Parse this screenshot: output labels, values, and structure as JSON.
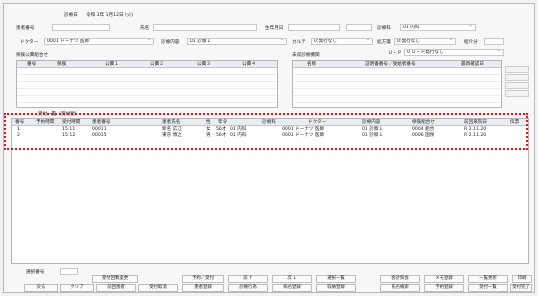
{
  "header": {
    "date_label": "診療日",
    "date_value": "令和 3年 1月12日 (火)",
    "patient_no_label": "患者番号",
    "name_label": "氏名",
    "birthdate_label": "生年月日",
    "dept_label": "診療科",
    "dept_value": "01 内科"
  },
  "row2": {
    "doctor_label": "ドクター",
    "doctor_value": "0001 ドーナツ 医師",
    "content_label": "診療内容",
    "content_value": "01 診察１",
    "karte_label": "カルテ",
    "karte_value": "0:発行なし",
    "prescription_label": "処方箋",
    "prescription_value": "0:発行なし",
    "referral_label": "紹介分"
  },
  "insurance": {
    "title": "保険公費組合せ",
    "columns": [
      "番号",
      "保険",
      "公費１",
      "公費２",
      "公費３",
      "公費４"
    ]
  },
  "receipt_option": {
    "label": "Ｕ・Ｐ",
    "value": "0 Ｕ・Ｐ発行なし"
  },
  "org": {
    "title": "未収診療機関",
    "columns": [
      "名称",
      "証明書番号／受給者番号",
      "最新確認日"
    ]
  },
  "list": {
    "section_label": "受付一覧（受付順）",
    "columns": [
      "番号",
      "予約時間",
      "受付時間",
      "患者番号",
      "患者氏名",
      "性",
      "年令",
      "診療科",
      "ドクター",
      "診療内容",
      "保険組合せ",
      "前回来院日",
      "伝票"
    ],
    "rows": [
      {
        "no": "1",
        "reserve": "",
        "time": "15:11",
        "patient_no": "00011",
        "name": "新名 広江",
        "sex": "女",
        "age": "56才",
        "dept": "01 内科",
        "doctor": "0001 ドーナツ 医師",
        "content": "01 診察１",
        "insurance": "0004 組合",
        "last": "R 2.11.20",
        "slip": ""
      },
      {
        "no": "2",
        "reserve": "",
        "time": "15:12",
        "patient_no": "00015",
        "name": "東京 博之",
        "sex": "男",
        "age": "56才",
        "dept": "01 内科",
        "doctor": "0001 ドーナツ 医師",
        "content": "01 診察１",
        "insurance": "0006 国保",
        "last": "R 2.11.20",
        "slip": ""
      }
    ]
  },
  "footer": {
    "visit_no_label": "選択番号",
    "top_buttons": [
      "受付回数変更",
      "予約／受付",
      "前 ↑",
      "次 ↓",
      "選択一覧",
      "会計照会",
      "メモ登録",
      "一覧更新",
      "印刷"
    ],
    "bottom_buttons": [
      "戻る",
      "クリア",
      "前回患者",
      "受付取消",
      "患者登録",
      "診療行為",
      "病名登録",
      "収納登録",
      "氏名検索",
      "予約登録",
      "受付一覧",
      "受付完了"
    ]
  }
}
